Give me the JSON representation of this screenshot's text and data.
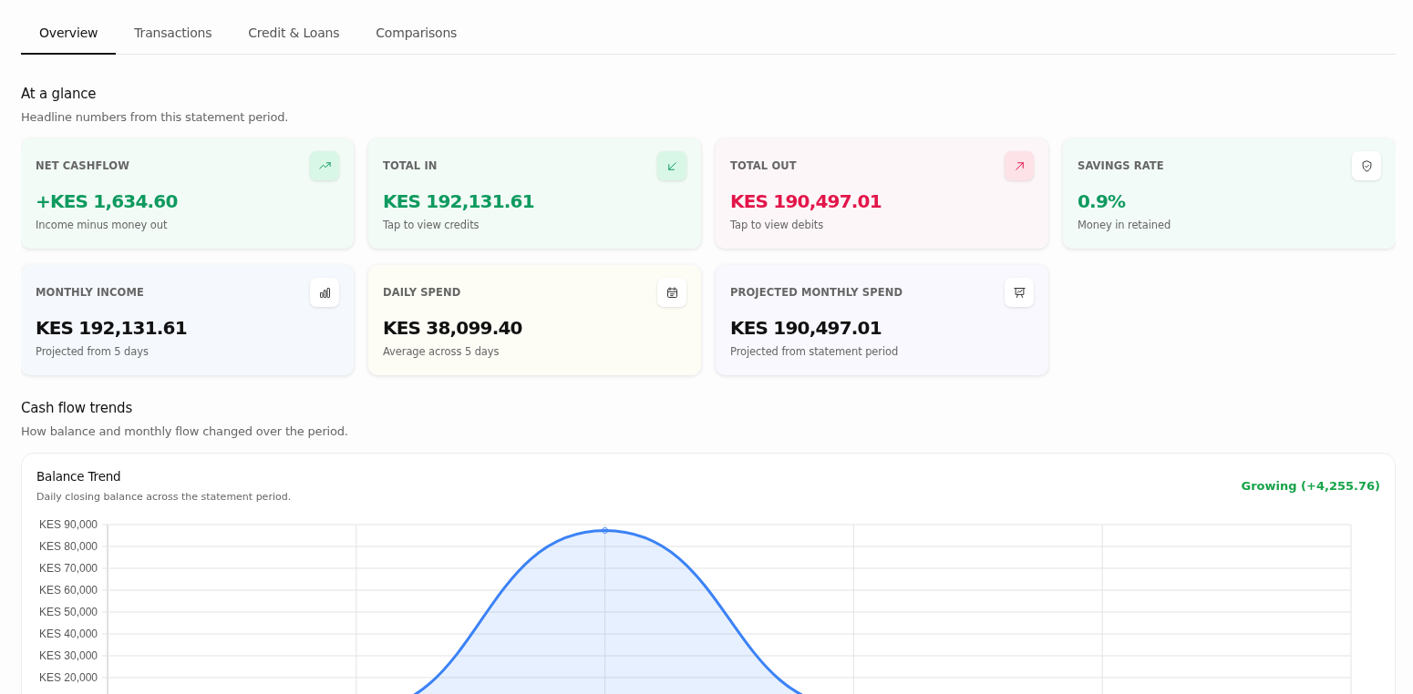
{
  "tabs": [
    {
      "label": "Overview",
      "selected": true
    },
    {
      "label": "Transactions",
      "selected": false
    },
    {
      "label": "Credit & Loans",
      "selected": false
    },
    {
      "label": "Comparisons",
      "selected": false
    }
  ],
  "at_a_glance": {
    "title": "At a glance",
    "subtitle": "Headline numbers from this statement period.",
    "cards": [
      {
        "kind": "cashflow",
        "label": "NET CASHFLOW",
        "value": "+KES 1,634.60",
        "note": "Income minus money out",
        "color": "#0f9a5f"
      },
      {
        "kind": "credits",
        "label": "TOTAL IN",
        "value": "KES 192,131.61",
        "note": "Tap to view credits",
        "color": "#0f9a5f"
      },
      {
        "kind": "debits",
        "label": "TOTAL OUT",
        "value": "KES 190,497.01",
        "note": "Tap to view debits",
        "color": "#e3154a"
      },
      {
        "kind": "savings",
        "label": "SAVINGS RATE",
        "value": "0.9%",
        "note": "Money in retained",
        "color": "#0f9a5f"
      },
      {
        "kind": "income",
        "label": "MONTHLY INCOME",
        "value": "KES 192,131.61",
        "note": "Projected from 5 days",
        "color": "#111111"
      },
      {
        "kind": "daily",
        "label": "DAILY SPEND",
        "value": "KES 38,099.40",
        "note": "Average across 5 days",
        "color": "#111111"
      },
      {
        "kind": "projection",
        "label": "PROJECTED MONTHLY SPEND",
        "value": "KES 190,497.01",
        "note": "Projected from statement period",
        "color": "#111111"
      }
    ]
  },
  "cash_flow_trends": {
    "title": "Cash flow trends",
    "subtitle": "How balance and monthly flow changed over the period.",
    "balance_trend": {
      "title": "Balance Trend",
      "subtitle": "Daily closing balance across the statement period.",
      "status": "Growing (+4,255.76)",
      "y_axis_labels": [
        "KES 90,000",
        "KES 80,000",
        "KES 70,000",
        "KES 60,000",
        "KES 50,000",
        "KES 40,000",
        "KES 30,000",
        "KES 20,000"
      ]
    }
  }
}
